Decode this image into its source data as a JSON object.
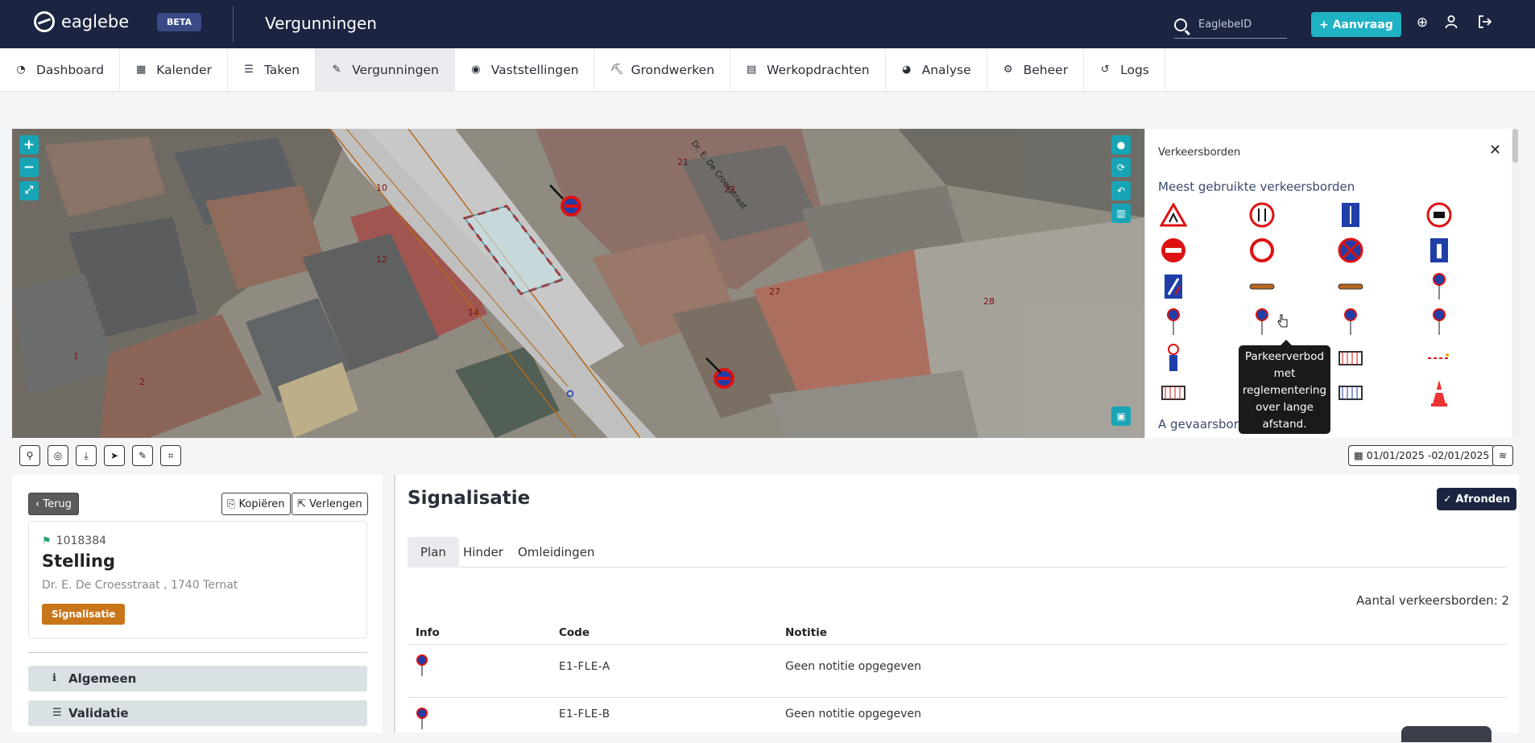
{
  "topbar": {
    "logo_text": "eaglebe",
    "beta_label": "BETA",
    "title": "Vergunningen",
    "search_placeholder": "EaglebeID",
    "aanvraag_label": "+ Aanvraag"
  },
  "nav": {
    "items": [
      {
        "label": "Dashboard",
        "icon": "dashboard-icon"
      },
      {
        "label": "Kalender",
        "icon": "calendar-icon"
      },
      {
        "label": "Taken",
        "icon": "tasks-icon"
      },
      {
        "label": "Vergunningen",
        "icon": "permit-icon"
      },
      {
        "label": "Vaststellingen",
        "icon": "eye-icon"
      },
      {
        "label": "Grondwerken",
        "icon": "digger-icon"
      },
      {
        "label": "Werkopdrachten",
        "icon": "document-icon"
      },
      {
        "label": "Analyse",
        "icon": "gauge-icon"
      },
      {
        "label": "Beheer",
        "icon": "gears-icon"
      },
      {
        "label": "Logs",
        "icon": "history-icon"
      }
    ],
    "active": "Vergunningen"
  },
  "map": {
    "street_label": "Dr. E. De Croesstraat",
    "house_numbers": [
      "10",
      "21",
      "23",
      "12",
      "27",
      "14",
      "28",
      "1",
      "2"
    ]
  },
  "panel": {
    "title": "Verkeersborden",
    "section_most_used": "Meest gebruikte verkeersborden",
    "section_next": "A gevaarsborden",
    "tooltip": "Parkeerverbod met reglementering over lange afstand."
  },
  "toolbar": {
    "date_range": "01/01/2025 -02/01/2025"
  },
  "detail": {
    "back_label": "Terug",
    "copy_label": "Kopiëren",
    "extend_label": "Verlengen",
    "id": "1018384",
    "name": "Stelling",
    "address": "Dr. E. De Croesstraat , 1740 Ternat",
    "badge": "Signalisatie",
    "accordion": [
      "Algemeen",
      "Validatie"
    ]
  },
  "main": {
    "heading": "Signalisatie",
    "afronden_label": "Afronden",
    "tabs": [
      "Plan",
      "Hinder",
      "Omleidingen"
    ],
    "count_text": "Aantal verkeersborden: 2",
    "columns": [
      "Info",
      "Code",
      "Notitie"
    ],
    "rows": [
      {
        "code": "E1-FLE-A",
        "note": "Geen notitie opgegeven"
      },
      {
        "code": "E1-FLE-B",
        "note": "Geen notitie opgegeven"
      }
    ]
  },
  "colors": {
    "topbar": "#1b2440",
    "accent": "#1fb2c4",
    "badge": "#c9761a"
  }
}
